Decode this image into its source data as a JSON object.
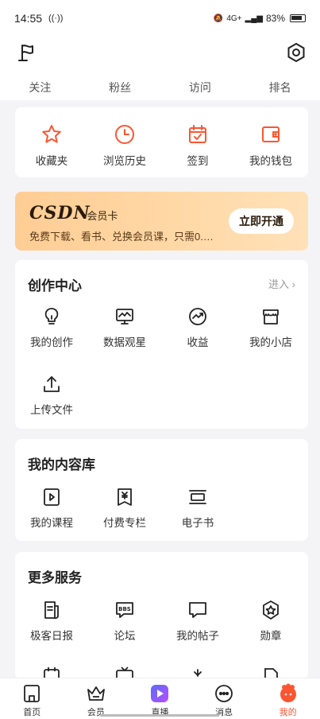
{
  "status_bar": {
    "time": "14:55",
    "network": "4G+",
    "battery": "83%"
  },
  "stats": [
    "关注",
    "粉丝",
    "访问",
    "排名"
  ],
  "quick_actions": [
    {
      "label": "收藏夹",
      "icon": "star-icon"
    },
    {
      "label": "浏览历史",
      "icon": "clock-icon"
    },
    {
      "label": "签到",
      "icon": "calendar-check-icon"
    },
    {
      "label": "我的钱包",
      "icon": "wallet-icon"
    }
  ],
  "vip": {
    "brand": "CSDN",
    "tag": "·会员卡",
    "desc": "免费下载、看书、兑换会员课，只需0.…",
    "button": "立即开通"
  },
  "creation_center": {
    "title": "创作中心",
    "enter": "进入 ›",
    "items": [
      {
        "label": "我的创作",
        "icon": "bulb-icon"
      },
      {
        "label": "数据观星",
        "icon": "monitor-chart-icon"
      },
      {
        "label": "收益",
        "icon": "trend-circle-icon"
      },
      {
        "label": "我的小店",
        "icon": "shop-icon"
      },
      {
        "label": "上传文件",
        "icon": "upload-icon"
      }
    ]
  },
  "content_library": {
    "title": "我的内容库",
    "items": [
      {
        "label": "我的课程",
        "icon": "play-square-icon"
      },
      {
        "label": "付费专栏",
        "icon": "yen-book-icon"
      },
      {
        "label": "电子书",
        "icon": "ebook-icon"
      }
    ]
  },
  "more_services": {
    "title": "更多服务",
    "items": [
      {
        "label": "极客日报",
        "icon": "daily-icon"
      },
      {
        "label": "论坛",
        "icon": "bbs-icon"
      },
      {
        "label": "我的帖子",
        "icon": "chat-bubble-icon"
      },
      {
        "label": "勋章",
        "icon": "medal-icon"
      }
    ]
  },
  "bottom_nav": [
    {
      "label": "首页",
      "icon": "home-icon"
    },
    {
      "label": "会员",
      "icon": "crown-icon"
    },
    {
      "label": "直播",
      "icon": "live-icon"
    },
    {
      "label": "消息",
      "icon": "message-icon"
    },
    {
      "label": "我的",
      "icon": "profile-icon",
      "active": true
    }
  ],
  "colors": {
    "accent": "#fc5531",
    "vip_gradient_start": "#ffcd94",
    "vip_gradient_end": "#ffe1b8"
  }
}
